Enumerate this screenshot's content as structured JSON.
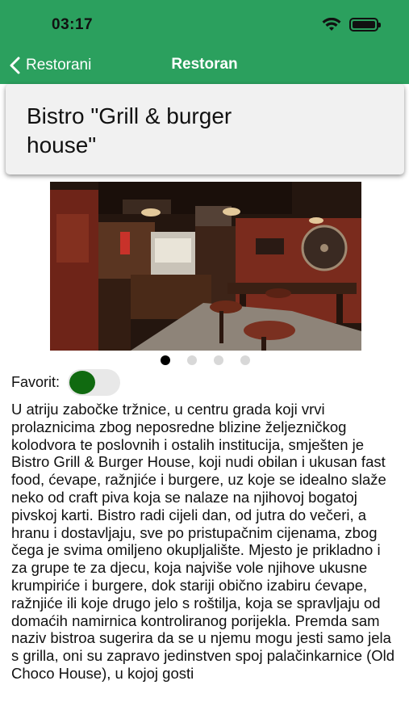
{
  "status_bar": {
    "time": "03:17"
  },
  "nav": {
    "back_label": "Restorani",
    "title": "Restoran"
  },
  "restaurant": {
    "name": "Bistro \"Grill & burger house\"",
    "favorite_label": "Favorit:",
    "favorite_on": true,
    "gallery": {
      "page_count": 4,
      "current_page": 1
    },
    "description": "U atriju zabočke tržnice, u centru grada koji vrvi prolaznicima zbog neposredne blizine željezničkog kolodvora te poslovnih i ostalih institucija, smješten je Bistro Grill & Burger House, koji nudi obilan i ukusan fast food, ćevape, ražnjiće i burgere, uz koje se idealno slaže neko od craft piva koja se nalaze na njihovoj bogatoj pivskoj karti. Bistro radi cijeli dan, od jutra do večeri, a hranu i dostavljaju, sve po pristupačnim cijenama, zbog čega je svima omiljeno okupljalište. Mjesto je prikladno i za grupe te za djecu, koja najviše vole njihove ukusne krumpiriće i burgere, dok stariji obično izabiru ćevape, ražnjiće ili koje drugo jelo s roštilja, koja se spravljaju od domaćih namirnica kontroliranog porijekla. Premda sam naziv bistroa sugerira da se u njemu mogu jesti samo jela s grilla, oni su zapravo jedinstven spoj palačinkarnice (Old Choco House), u kojoj gosti"
  },
  "colors": {
    "header": "#2ba05e",
    "toggle_knob": "#106a10"
  }
}
